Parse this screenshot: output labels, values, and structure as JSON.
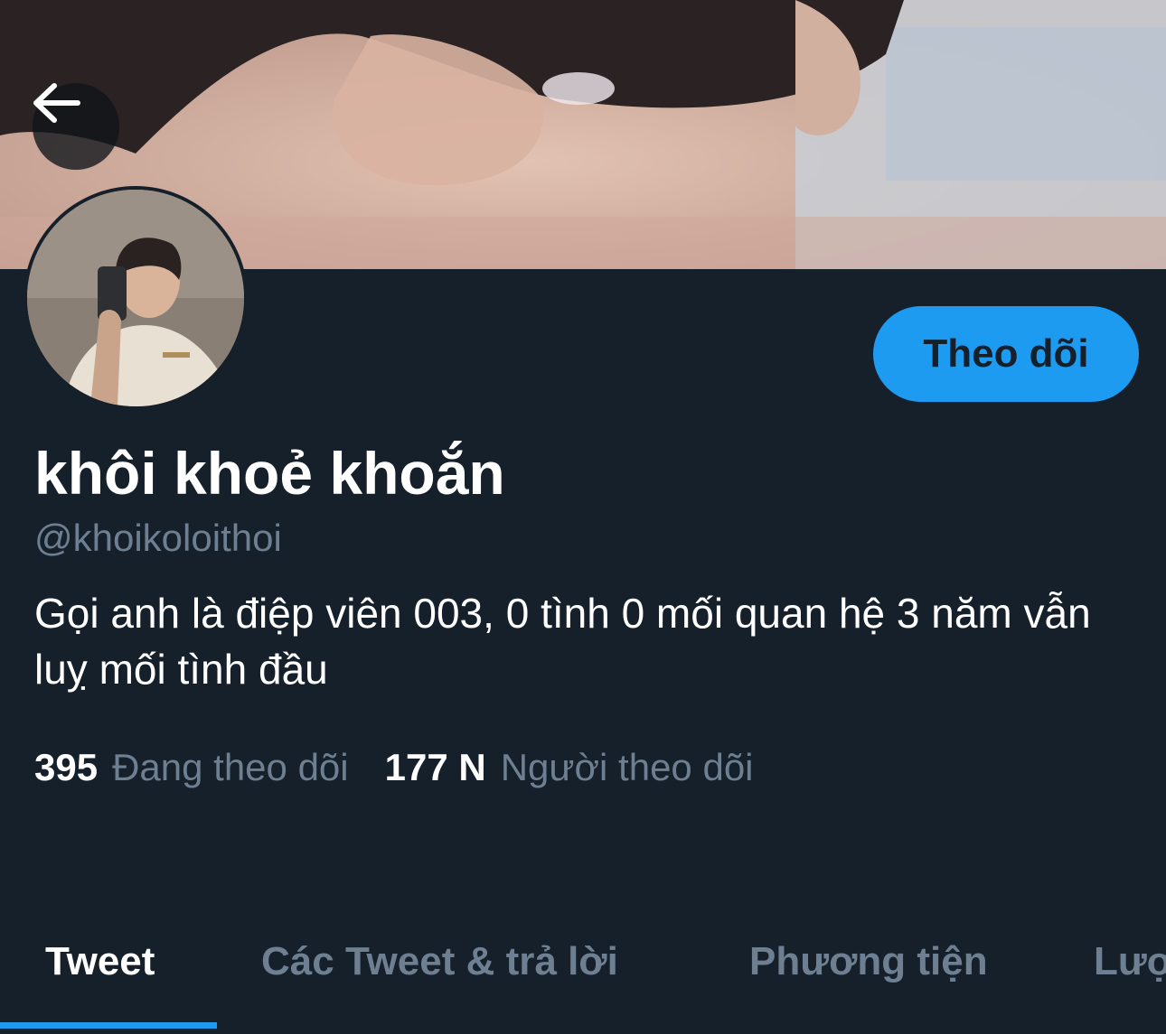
{
  "header": {
    "back_button": {
      "icon": "arrow-left-icon"
    }
  },
  "profile": {
    "display_name": "khôi khoẻ khoắn",
    "handle": "@khoikoloithoi",
    "bio": "Gọi anh là điệp viên 003, 0 tình 0 mối quan hệ 3 năm vẫn luỵ mối tình đầu",
    "follow_label": "Theo dõi",
    "stats": {
      "following_count": "395",
      "following_label": "Đang theo dõi",
      "followers_count": "177 N",
      "followers_label": "Người theo dõi"
    }
  },
  "tabs": [
    {
      "label": "Tweet",
      "active": true
    },
    {
      "label": "Các Tweet & trả lời",
      "active": false
    },
    {
      "label": "Phương tiện",
      "active": false
    },
    {
      "label": "Lượt thích",
      "active": false
    }
  ],
  "colors": {
    "background": "#15202b",
    "accent": "#1d9bf0",
    "primary_text": "#ffffff",
    "secondary_text": "#6e7f91"
  }
}
